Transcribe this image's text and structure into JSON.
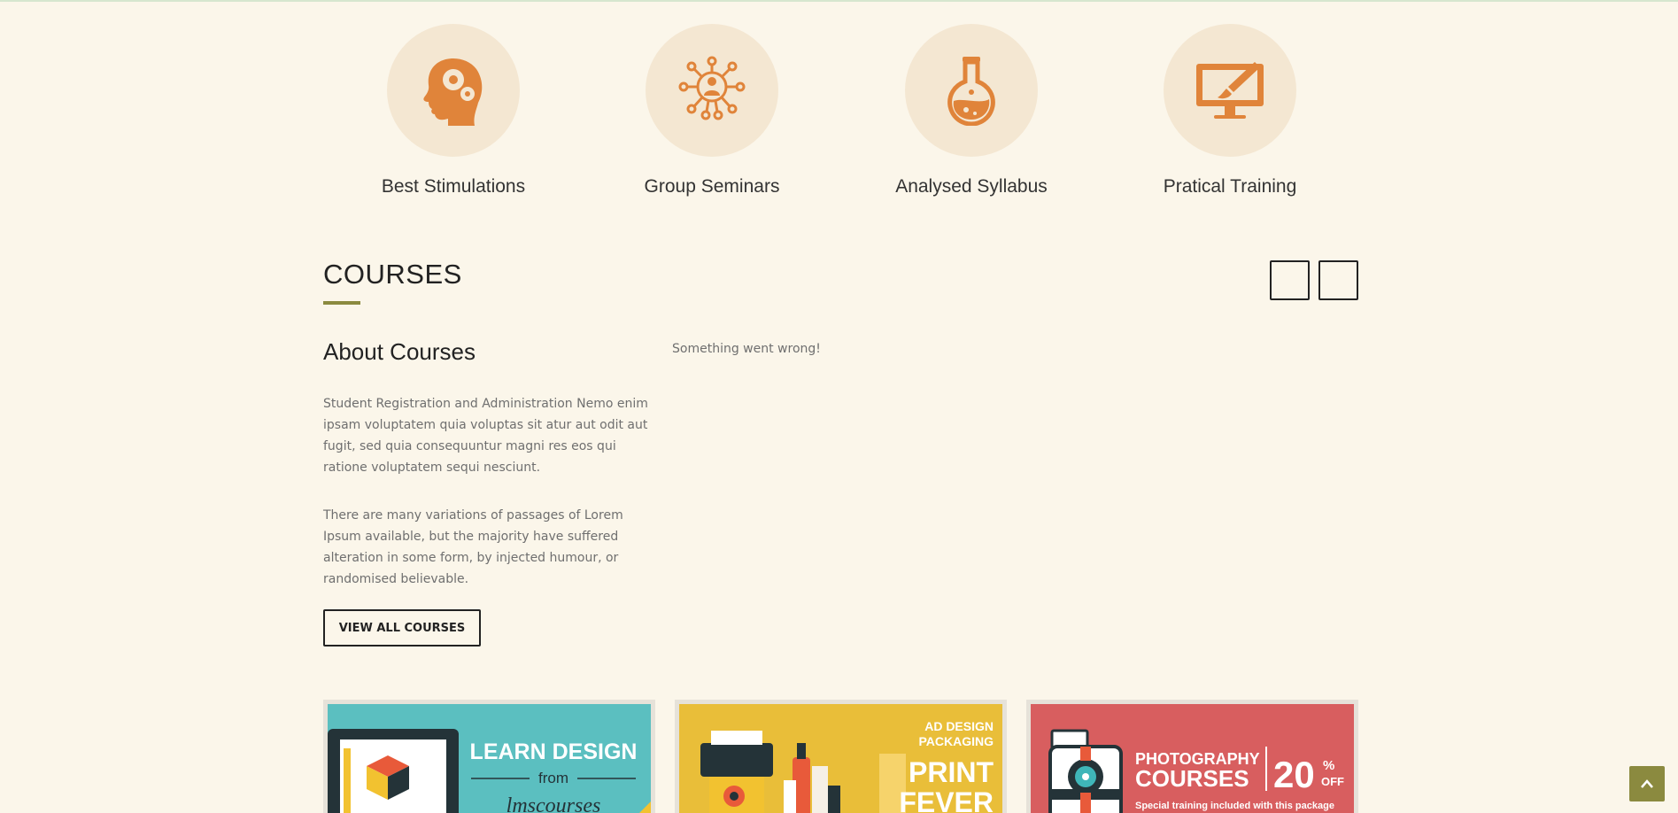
{
  "features": [
    {
      "title": "Best Stimulations",
      "icon": "brain-head-icon"
    },
    {
      "title": "Group Seminars",
      "icon": "network-people-icon"
    },
    {
      "title": "Analysed Syllabus",
      "icon": "flask-icon"
    },
    {
      "title": "Pratical Training",
      "icon": "monitor-brush-icon"
    }
  ],
  "courses": {
    "heading": "COURSES",
    "about_title": "About Courses",
    "about_p1": "Student Registration and Administration Nemo enim ipsam voluptatem quia voluptas sit atur aut odit aut fugit, sed quia consequuntur magni res eos qui ratione voluptatem sequi nesciunt.",
    "about_p2": "There are many variations of passages of Lorem Ipsum available, but the majority have suffered alteration in some form, by injected humour, or randomised believable.",
    "view_all_label": "VIEW ALL COURSES",
    "error_message": "Something went wrong!"
  },
  "cards": [
    {
      "line1": "LEARN DESIGN",
      "line2": "from",
      "line3": "lmscourses"
    },
    {
      "line1": "AD DESIGN",
      "line2": "PACKAGING",
      "line3": "PRINT",
      "line4": "FEVER"
    },
    {
      "line1": "PHOTOGRAPHY",
      "line2": "COURSES",
      "discount": "20",
      "percent": "%",
      "off": "OFF",
      "tagline": "Special training included with this package"
    }
  ],
  "colors": {
    "accent": "#8b8a3f",
    "icon_orange": "#e0843a",
    "circle_bg": "#f4e7d2",
    "page_bg": "#fbf6ea"
  }
}
